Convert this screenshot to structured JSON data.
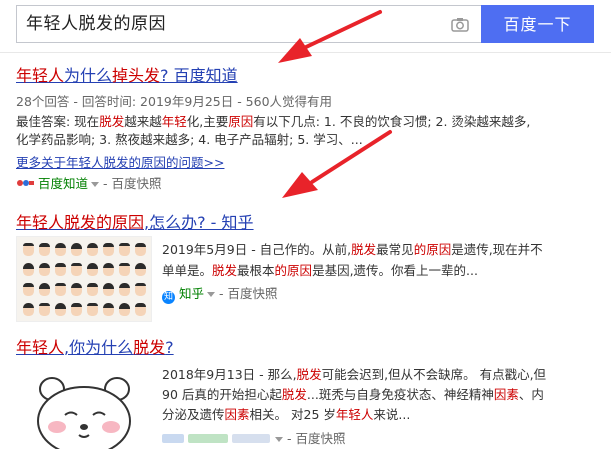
{
  "search": {
    "query": "年轻人脱发的原因",
    "button_label": "百度一下",
    "camera_icon": "camera-icon"
  },
  "results": [
    {
      "title": {
        "hl1": "年轻人",
        "plain1": "为什么",
        "hl2": "掉头发",
        "plain2": "? 百度知道"
      },
      "meta": "28个回答 - 回答时间: 2019年9月25日 - 560人觉得有用",
      "lines": [
        {
          "a": "最佳答案: 现在",
          "b": "脱发",
          "c": "越来越",
          "d": "年轻",
          "e": "化,主要",
          "f": "原因",
          "g": "有以下几点: 1. 不良的饮食习惯; 2. 烫染越来越多,"
        },
        {
          "a": "化学药品影响; 3. 熬夜越来越多; 4. 电子产品辐射; 5. 学习、..."
        }
      ],
      "more": "更多关于年轻人脱发的原因的问题>>",
      "source_site": "百度知道",
      "source_snap": "- 百度快照"
    },
    {
      "title": {
        "hl1": "年轻人脱发的原因",
        "plain1": ",怎么办? - 知乎"
      },
      "line1": {
        "a": "2019年5月9日 - 自己作的。从前,",
        "b": "脱发",
        "c": "最常见",
        "d": "的原因",
        "e": "是遗传,现在并不"
      },
      "line2": {
        "a": "单单是。",
        "b": "脱发",
        "c": "最根本",
        "d": "的原因",
        "e": "是基因,遗传。你看上一辈的..."
      },
      "source_badge": "知",
      "source_site": "知乎",
      "source_snap": "- 百度快照"
    },
    {
      "title": {
        "hl1": "年轻人",
        "plain1": ",你为什么",
        "hl2": "脱发",
        "plain2": "?"
      },
      "line1": {
        "a": "2018年9月13日 - 那么,",
        "b": "脱发",
        "c": "可能会迟到,但从不会缺席。 有点戳心,但"
      },
      "line2": {
        "a": "90 后真的开始担心起",
        "b": "脱发",
        "c": "...斑秃与自身免疫状态、神经精神",
        "d": "因素",
        "e": "、内"
      },
      "line3": {
        "a": "分泌及遗传",
        "b": "因素",
        "c": "相关。 对25 岁",
        "d": "年轻人",
        "e": "来说..."
      },
      "source_snap": "- 百度快照"
    }
  ],
  "colors": {
    "link": "#2440b3",
    "highlight": "#c00000",
    "button": "#4e6ef2",
    "source_green": "#008000",
    "arrow_red": "#e8232a"
  }
}
